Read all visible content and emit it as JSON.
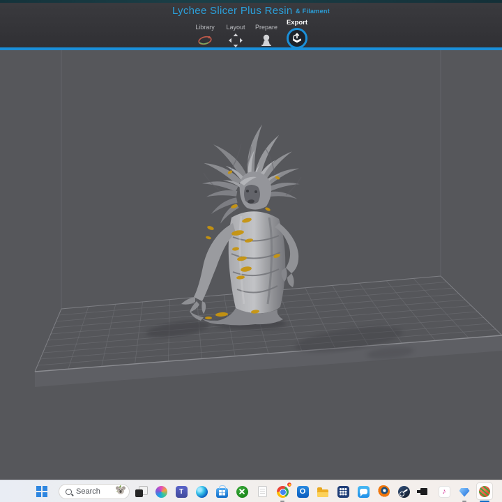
{
  "header": {
    "title": "Lychee Slicer Plus Resin",
    "title_suffix": "& Filament",
    "title_color": "#2b9fd9",
    "accent_color": "#1b8fd8",
    "tabs": [
      {
        "label": "Library",
        "active": false
      },
      {
        "label": "Layout",
        "active": false
      },
      {
        "label": "Prepare",
        "active": false
      },
      {
        "label": "Export",
        "active": true
      }
    ]
  },
  "viewport": {
    "background_color": "#56575b",
    "plate_surface_color": "#55565a",
    "plate_grid_color": "#707176",
    "model": {
      "body_color": "#9a9b9f",
      "island_highlight_color": "#c6940f"
    }
  },
  "taskbar": {
    "background_color": "#eff0f2",
    "search_placeholder": "Search",
    "active_app": "lychee-slicer",
    "icons": [
      "windows-start",
      "search",
      "task-view",
      "copilot",
      "teams",
      "edge",
      "microsoft-store",
      "xbox",
      "notepad",
      "chrome",
      "outlook",
      "file-explorer",
      "app-grid",
      "messenger",
      "blender",
      "steam",
      "capture",
      "itunes",
      "gem",
      "lychee-slicer"
    ]
  }
}
